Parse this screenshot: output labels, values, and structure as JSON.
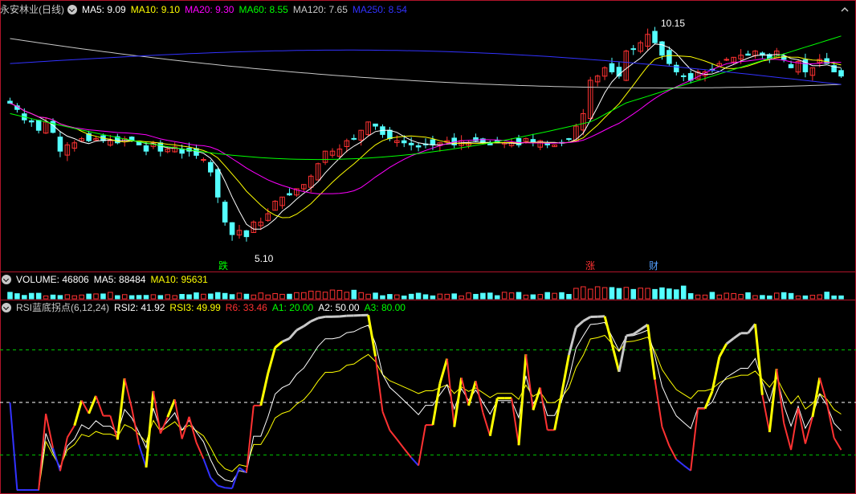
{
  "main_legend": {
    "stock": "永安林业(日线)",
    "ma5": "MA5: 9.09",
    "ma10": "MA10: 9.10",
    "ma20": "MA20: 9.30",
    "ma60": "MA60: 8.55",
    "ma120": "MA120: 7.65",
    "ma250": "MA250: 8.54"
  },
  "volume_legend": {
    "name": "VOLUME: 46806",
    "ma5": "MA5: 88484",
    "ma10": "MA10: 95631"
  },
  "rsi_legend": {
    "name": "RSI蓝底拐点(6,12,24)",
    "rsi2": "RSI2: 41.92",
    "rsi3": "RSI3: 49.99",
    "r6": "R6: 33.46",
    "a1": "A1: 20.00",
    "a2": "A2: 50.00",
    "a3": "A3: 80.00"
  },
  "annotations": {
    "high": "10.15",
    "low": "5.10",
    "mark_fall": "跌",
    "mark_rise": "涨",
    "mark_fin": "财"
  },
  "colors": {
    "up": "#ff3232",
    "down": "#54ffff",
    "ma5": "#ffffff",
    "ma10": "#ffff00",
    "ma20": "#ff00ff",
    "ma60": "#00ff00",
    "ma120": "#c8c8c8",
    "ma250": "#3232ff",
    "grid": "#b0142a"
  },
  "chart_data": [
    {
      "type": "candlestick",
      "title": "永安林业(日线)",
      "y_annotations": [
        {
          "label": "10.15",
          "value": 10.15,
          "kind": "high"
        },
        {
          "label": "5.10",
          "value": 5.1,
          "kind": "low"
        }
      ],
      "closes": [
        8.45,
        8.3,
        8.05,
        8.0,
        7.8,
        8.0,
        7.75,
        7.3,
        7.45,
        7.5,
        7.6,
        7.55,
        7.6,
        7.55,
        7.55,
        7.5,
        7.6,
        7.55,
        7.45,
        7.3,
        7.5,
        7.3,
        7.35,
        7.4,
        7.25,
        7.3,
        7.2,
        7.1,
        6.8,
        6.2,
        5.6,
        5.3,
        5.4,
        5.25,
        5.6,
        5.6,
        5.8,
        6.1,
        6.2,
        6.25,
        6.4,
        6.5,
        6.7,
        7.0,
        7.3,
        7.3,
        7.35,
        7.55,
        7.6,
        7.8,
        8.0,
        7.9,
        7.7,
        7.6,
        7.55,
        7.5,
        7.45,
        7.4,
        7.45,
        7.45,
        7.5,
        7.55,
        7.45,
        7.55,
        7.5,
        7.55,
        7.5,
        7.45,
        7.5,
        7.5,
        7.5,
        7.45,
        7.6,
        7.5,
        7.55,
        7.45,
        7.45,
        7.5,
        7.6,
        7.9,
        8.2,
        9.0,
        9.1,
        9.3,
        9.2,
        9.1,
        9.7,
        9.75,
        9.9,
        10.1,
        9.9,
        9.6,
        9.4,
        9.2,
        9.1,
        9.0,
        9.2,
        9.2,
        9.25,
        9.4,
        9.5,
        9.55,
        9.6,
        9.6,
        9.7,
        9.6,
        9.5,
        9.7,
        9.5,
        9.3,
        9.45,
        9.2,
        9.3,
        9.5,
        9.4,
        9.2,
        9.1
      ],
      "ma_lines": [
        "MA5",
        "MA10",
        "MA20",
        "MA60",
        "MA120",
        "MA250"
      ]
    },
    {
      "type": "bar",
      "title": "VOLUME",
      "series": [
        {
          "name": "VOLUME",
          "latest": 46806
        },
        {
          "name": "MA5",
          "latest": 88484
        },
        {
          "name": "MA10",
          "latest": 95631
        }
      ]
    },
    {
      "type": "line",
      "title": "RSI蓝底拐点(6,12,24)",
      "ylim": [
        0,
        100
      ],
      "reference_lines": [
        {
          "name": "A1",
          "value": 20
        },
        {
          "name": "A2",
          "value": 50
        },
        {
          "name": "A3",
          "value": 80
        }
      ],
      "series": [
        {
          "name": "R6",
          "latest": 33.46
        },
        {
          "name": "RSI2",
          "latest": 41.92
        },
        {
          "name": "RSI3",
          "latest": 49.99
        }
      ]
    }
  ]
}
